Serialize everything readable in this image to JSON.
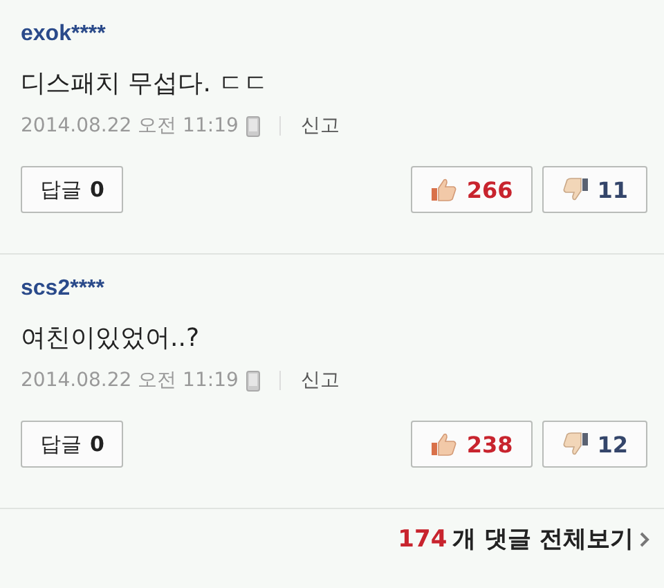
{
  "comments": [
    {
      "author": "exok****",
      "text": "디스패치 무섭다. ㄷㄷ",
      "time": "2014.08.22 오전 11:19",
      "report": "신고",
      "reply": {
        "label": "답글",
        "count": "0"
      },
      "likes": "266",
      "dislikes": "11"
    },
    {
      "author": "scs2****",
      "text": "여친이있었어..?",
      "time": "2014.08.22 오전 11:19",
      "report": "신고",
      "reply": {
        "label": "답글",
        "count": "0"
      },
      "likes": "238",
      "dislikes": "12"
    }
  ],
  "footer": {
    "count": "174",
    "label": "개 댓글 전체보기"
  }
}
